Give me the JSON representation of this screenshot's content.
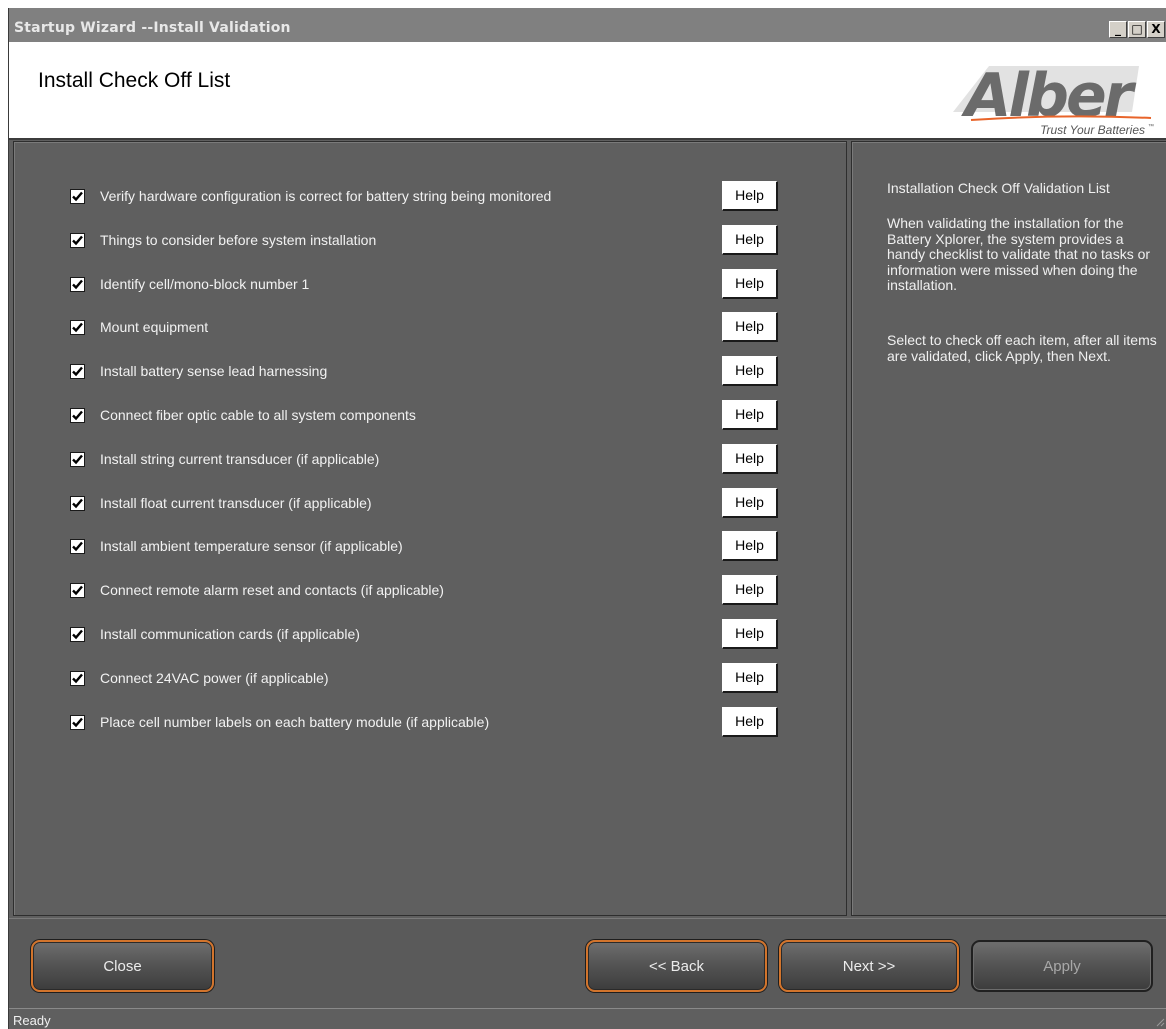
{
  "window": {
    "title": "Startup Wizard --Install Validation",
    "controls": {
      "minimize": "_",
      "maximize": "□",
      "close": "X"
    }
  },
  "header": {
    "title": "Install Check Off List",
    "logo": {
      "brand": "Alber",
      "tagline": "Trust Your Batteries",
      "tm": "™"
    }
  },
  "checklist": [
    {
      "label": "Verify hardware configuration is correct for battery string being monitored",
      "checked": true,
      "help_label": "Help"
    },
    {
      "label": "Things to consider before system installation",
      "checked": true,
      "help_label": "Help"
    },
    {
      "label": "Identify cell/mono-block number 1",
      "checked": true,
      "help_label": "Help"
    },
    {
      "label": "Mount equipment",
      "checked": true,
      "help_label": "Help"
    },
    {
      "label": "Install battery sense lead harnessing",
      "checked": true,
      "help_label": "Help"
    },
    {
      "label": "Connect fiber optic cable to all system components",
      "checked": true,
      "help_label": "Help"
    },
    {
      "label": "Install string current transducer (if applicable)",
      "checked": true,
      "help_label": "Help"
    },
    {
      "label": "Install float current transducer (if applicable)",
      "checked": true,
      "help_label": "Help"
    },
    {
      "label": "Install ambient temperature sensor (if applicable)",
      "checked": true,
      "help_label": "Help"
    },
    {
      "label": "Connect remote alarm reset and contacts (if applicable)",
      "checked": true,
      "help_label": "Help"
    },
    {
      "label": "Install communication cards (if applicable)",
      "checked": true,
      "help_label": "Help"
    },
    {
      "label": "Connect 24VAC power (if applicable)",
      "checked": true,
      "help_label": "Help"
    },
    {
      "label": "Place cell number labels on each battery module (if applicable)",
      "checked": true,
      "help_label": "Help"
    }
  ],
  "side_panel": {
    "title": "Installation Check Off Validation List",
    "paragraph1": "When validating the installation for the Battery Xplorer, the system provides a handy checklist to validate that no tasks or information were missed when doing the installation.",
    "paragraph2": "Select to check off each item, after all items are validated, click Apply, then Next."
  },
  "footer": {
    "close_label": "Close",
    "back_label": "<< Back",
    "next_label": "Next >>",
    "apply_label": "Apply"
  },
  "status": {
    "text": "Ready"
  },
  "colors": {
    "accent_orange": "#d2742c",
    "logo_orange": "#e8642a",
    "logo_gray": "#6b6b6b"
  }
}
